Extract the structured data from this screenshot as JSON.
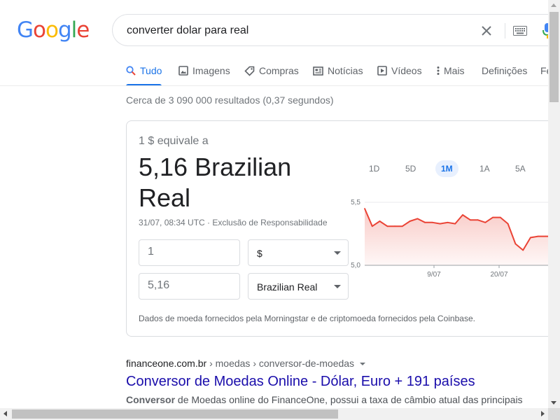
{
  "logo": {
    "letters": [
      "G",
      "o",
      "o",
      "g",
      "l",
      "e"
    ],
    "colors": [
      "#4285f4",
      "#ea4335",
      "#fbbc05",
      "#4285f4",
      "#34a853",
      "#ea4335"
    ]
  },
  "search": {
    "query": "converter dolar para real"
  },
  "tabs": [
    {
      "label": "Tudo",
      "icon": "search-icon",
      "active": true
    },
    {
      "label": "Imagens",
      "icon": "image-icon"
    },
    {
      "label": "Compras",
      "icon": "tag-icon"
    },
    {
      "label": "Notícias",
      "icon": "newspaper-icon"
    },
    {
      "label": "Vídeos",
      "icon": "play-icon"
    },
    {
      "label": "Mais",
      "icon": "more-vert-icon"
    },
    {
      "label": "Definições"
    },
    {
      "label": "Fe"
    }
  ],
  "stats": "Cerca de 3 090 000 resultados (0,37 segundos)",
  "converter": {
    "equiv_label": "1 $ equivale a",
    "equiv_value": "5,16 Brazilian Real",
    "timestamp": "31/07, 08:34 UTC · Exclusão de Responsabilidade",
    "from_amount": "1",
    "from_currency": "$",
    "to_amount": "5,16",
    "to_currency": "Brazilian Real",
    "disclaimer": "Dados de moeda fornecidos pela Morningstar e de criptomoeda fornecidos pela Coinbase.",
    "ranges": [
      "1D",
      "5D",
      "1M",
      "1A",
      "5A"
    ],
    "active_range": "1M"
  },
  "chart_data": {
    "type": "area",
    "color": "#ea4335",
    "y_ticks": [
      "5,5",
      "5,0"
    ],
    "ylim": [
      5.0,
      5.5
    ],
    "x_ticks": [
      "9/07",
      "20/07"
    ],
    "values": [
      5.45,
      5.31,
      5.35,
      5.31,
      5.31,
      5.31,
      5.35,
      5.37,
      5.34,
      5.34,
      5.33,
      5.34,
      5.33,
      5.4,
      5.36,
      5.36,
      5.34,
      5.38,
      5.38,
      5.33,
      5.17,
      5.12,
      5.22,
      5.23,
      5.23,
      5.23,
      5.14
    ]
  },
  "result": {
    "domain": "financeone.com.br",
    "crumbs": " › moedas › conversor-de-moedas",
    "title": "Conversor de Moedas Online - Dólar, Euro + 191 países",
    "snippet_bold": "Conversor",
    "snippet_rest": " de Moedas online do FinanceOne, possui a taxa de câmbio atual das principais"
  }
}
